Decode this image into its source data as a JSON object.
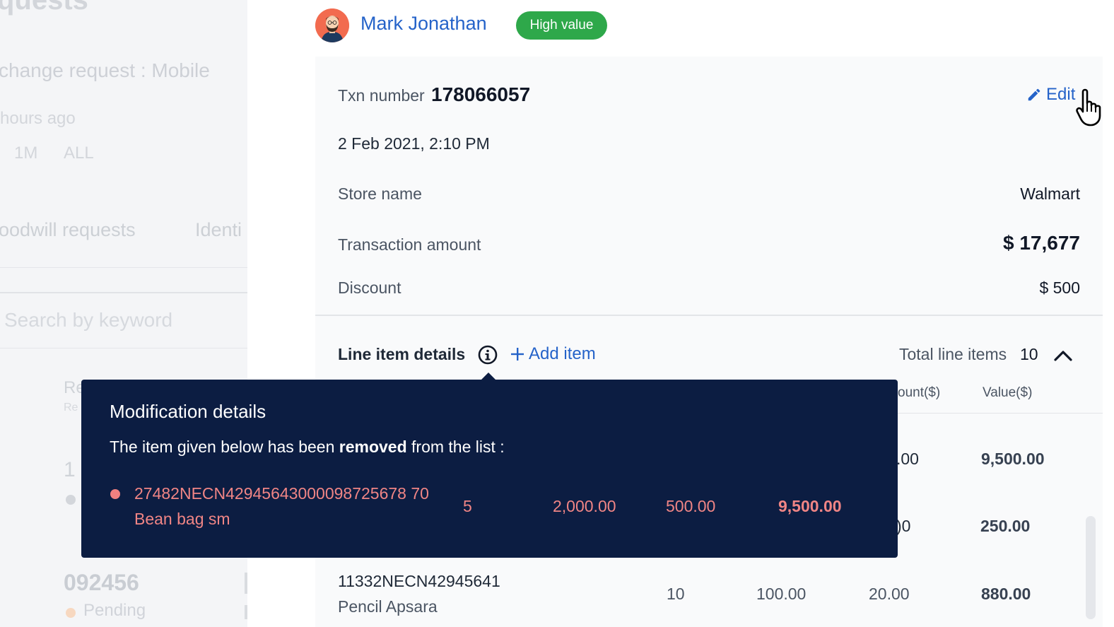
{
  "background": {
    "title": "quests",
    "subtitle": "change request : Mobile",
    "time": "hours ago",
    "ranges": [
      "1M",
      "ALL"
    ],
    "tabs": [
      "oodwill requests",
      "Identi"
    ],
    "search_placeholder": "Search by keyword",
    "row_a_heading": "Re",
    "row_a_sub": "Re",
    "row_b_id": "1",
    "row_c_id": "092456",
    "row_c_status": "Pending"
  },
  "customer": {
    "name": "Mark Jonathan",
    "badge": "High value",
    "avatar_icon": "avatar-icon"
  },
  "transaction": {
    "txn_label": "Txn number",
    "txn_number": "178066057",
    "edit_label": "Edit",
    "date": "2 Feb 2021, 2:10 PM",
    "store_label": "Store name",
    "store_value": "Walmart",
    "amount_label": "Transaction amount",
    "amount_value": "$ 17,677",
    "discount_label": "Discount",
    "discount_value": "$ 500"
  },
  "line_items": {
    "title": "Line item details",
    "add_item_label": "Add item",
    "total_label": "Total line items",
    "total_count": "10",
    "columns": {
      "discount_partial": "ount($)",
      "value": "Value($)"
    },
    "rows": [
      {
        "discount_partial": ".00",
        "value": "9,500.00"
      },
      {
        "discount_partial": ")0",
        "value": "250.00"
      },
      {
        "code": "11332NECN42945641",
        "name": "Pencil Apsara",
        "qty": "10",
        "price": "100.00",
        "discount": "20.00",
        "value": "880.00"
      }
    ]
  },
  "tooltip": {
    "title": "Modification details",
    "desc_before": "The item given below has been",
    "desc_bold": "removed",
    "desc_after": "from the list :",
    "item": {
      "code": "27482NECN42945643000098725678 70",
      "name": "Bean bag sm",
      "qty": "5",
      "price": "2,000.00",
      "discount": "500.00",
      "value": "9,500.00"
    }
  },
  "colors": {
    "accent": "#2563c9",
    "badge": "#2ea84a",
    "tooltip_bg": "#0c1d42",
    "removed": "#f08585"
  }
}
